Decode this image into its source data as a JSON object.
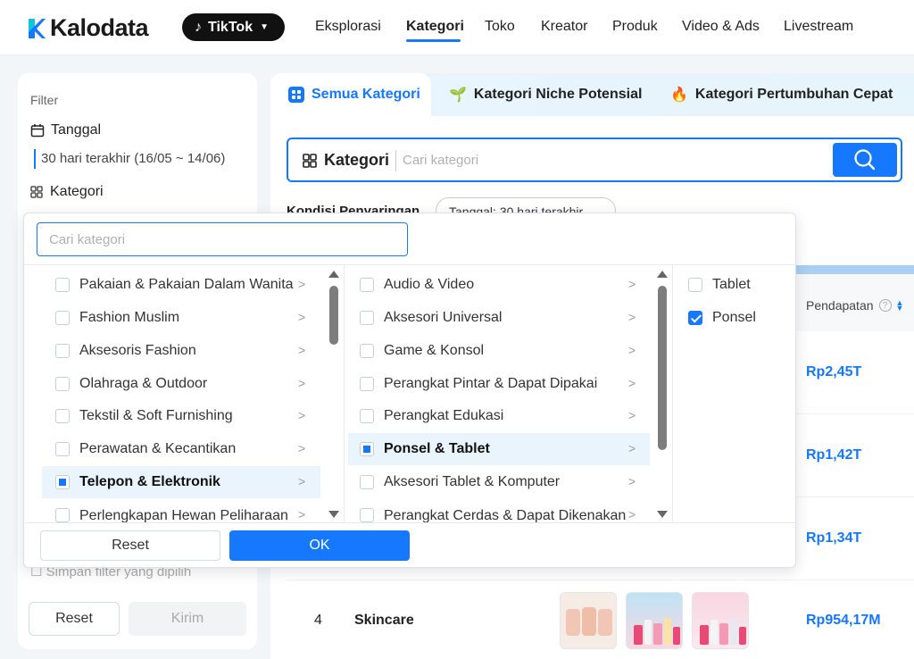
{
  "header": {
    "logo": "Kalodata",
    "platform": "TikTok",
    "nav": [
      "Eksplorasi",
      "Kategori",
      "Toko",
      "Kreator",
      "Produk",
      "Video & Ads",
      "Livestream"
    ],
    "active_nav": "Kategori"
  },
  "filter": {
    "title": "Filter",
    "tanggal_label": "Tanggal",
    "date_range": "30 hari terakhir (16/05 ~ 14/06)",
    "kategori_label": "Kategori",
    "save_label": "Simpan filter yang dipilih",
    "reset_label": "Reset",
    "submit_label": "Kirim"
  },
  "main": {
    "tabs": [
      "Semua Kategori",
      "Kategori Niche Potensial",
      "Kategori Pertumbuhan Cepat"
    ],
    "search_label": "Kategori",
    "search_placeholder": "Cari kategori",
    "kondisi_label": "Kondisi Penyaringan",
    "chip_label": "Tanggal: 30 hari terakhir",
    "revenue_header": "Pendapatan",
    "rows": [
      {
        "revenue": "Rp2,45T"
      },
      {
        "revenue": "Rp1,42T"
      },
      {
        "revenue": "Rp1,34T"
      },
      {
        "rank": "4",
        "name": "Skincare",
        "revenue": "Rp954,17M"
      }
    ]
  },
  "dropdown": {
    "search_placeholder": "Cari kategori",
    "col1": [
      "Pakaian & Pakaian Dalam Wanita",
      "Fashion Muslim",
      "Aksesoris Fashion",
      "Olahraga & Outdoor",
      "Tekstil & Soft Furnishing",
      "Perawatan & Kecantikan",
      "Telepon & Elektronik",
      "Perlengkapan Hewan Peliharaan"
    ],
    "col2": [
      "Audio & Video",
      "Aksesori Universal",
      "Game & Konsol",
      "Perangkat Pintar & Dapat Dipakai",
      "Perangkat Edukasi",
      "Ponsel & Tablet",
      "Aksesori Tablet & Komputer",
      "Perangkat Cerdas & Dapat Dikenakan"
    ],
    "col3": [
      "Tablet",
      "Ponsel"
    ],
    "reset_label": "Reset",
    "ok_label": "OK",
    "accent": "#1677ff"
  }
}
